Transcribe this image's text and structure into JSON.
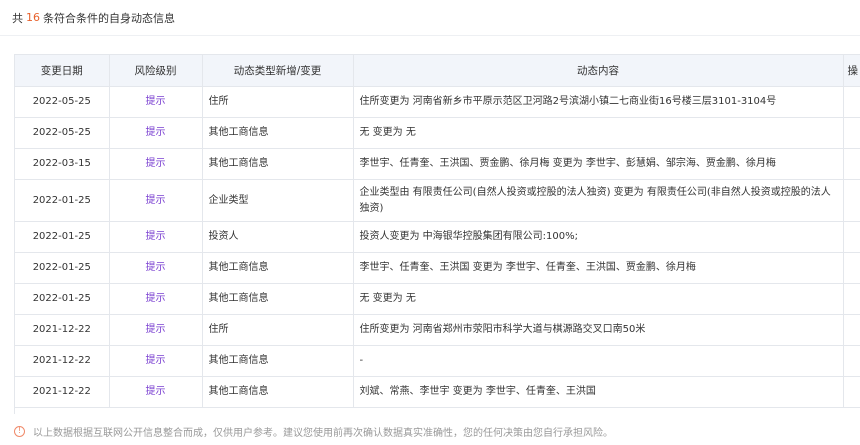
{
  "summary": {
    "prefix": "共",
    "count": "16",
    "suffix": "条符合条件的自身动态信息"
  },
  "table": {
    "headers": [
      "变更日期",
      "风险级别",
      "动态类型新增/变更",
      "动态内容",
      "操"
    ],
    "rows": [
      {
        "date": "2022-05-25",
        "risk": "提示",
        "type": "住所",
        "content": "住所变更为 河南省新乡市平原示范区卫河路2号滨湖小镇二七商业街16号楼三层3101-3104号"
      },
      {
        "date": "2022-05-25",
        "risk": "提示",
        "type": "其他工商信息",
        "content": "无 变更为 无"
      },
      {
        "date": "2022-03-15",
        "risk": "提示",
        "type": "其他工商信息",
        "content": "李世宇、任青奎、王洪国、贾金鹏、徐月梅 变更为 李世宇、彭慧娟、邹宗海、贾金鹏、徐月梅"
      },
      {
        "date": "2022-01-25",
        "risk": "提示",
        "type": "企业类型",
        "content": "企业类型由 有限责任公司(自然人投资或控股的法人独资) 变更为 有限责任公司(非自然人投资或控股的法人独资)"
      },
      {
        "date": "2022-01-25",
        "risk": "提示",
        "type": "投资人",
        "content": "投资人变更为 中海银华控股集团有限公司:100%;"
      },
      {
        "date": "2022-01-25",
        "risk": "提示",
        "type": "其他工商信息",
        "content": "李世宇、任青奎、王洪国 变更为 李世宇、任青奎、王洪国、贾金鹏、徐月梅"
      },
      {
        "date": "2022-01-25",
        "risk": "提示",
        "type": "其他工商信息",
        "content": "无 变更为 无"
      },
      {
        "date": "2021-12-22",
        "risk": "提示",
        "type": "住所",
        "content": "住所变更为 河南省郑州市荥阳市科学大道与棋源路交叉口南50米"
      },
      {
        "date": "2021-12-22",
        "risk": "提示",
        "type": "其他工商信息",
        "content": "-"
      },
      {
        "date": "2021-12-22",
        "risk": "提示",
        "type": "其他工商信息",
        "content": "刘斌、常燕、李世宇 变更为 李世宇、任青奎、王洪国"
      }
    ]
  },
  "footer": {
    "icon": "info-icon",
    "text": "以上数据根据互联网公开信息整合而成，仅供用户参考。建议您使用前再次确认数据真实准确性，您的任何决策由您自行承担风险。"
  },
  "colors": {
    "accent_count": "#e8612c",
    "risk_link": "#7a3fd1",
    "header_bg": "#f2f5fa",
    "border": "#e4e7ec"
  }
}
